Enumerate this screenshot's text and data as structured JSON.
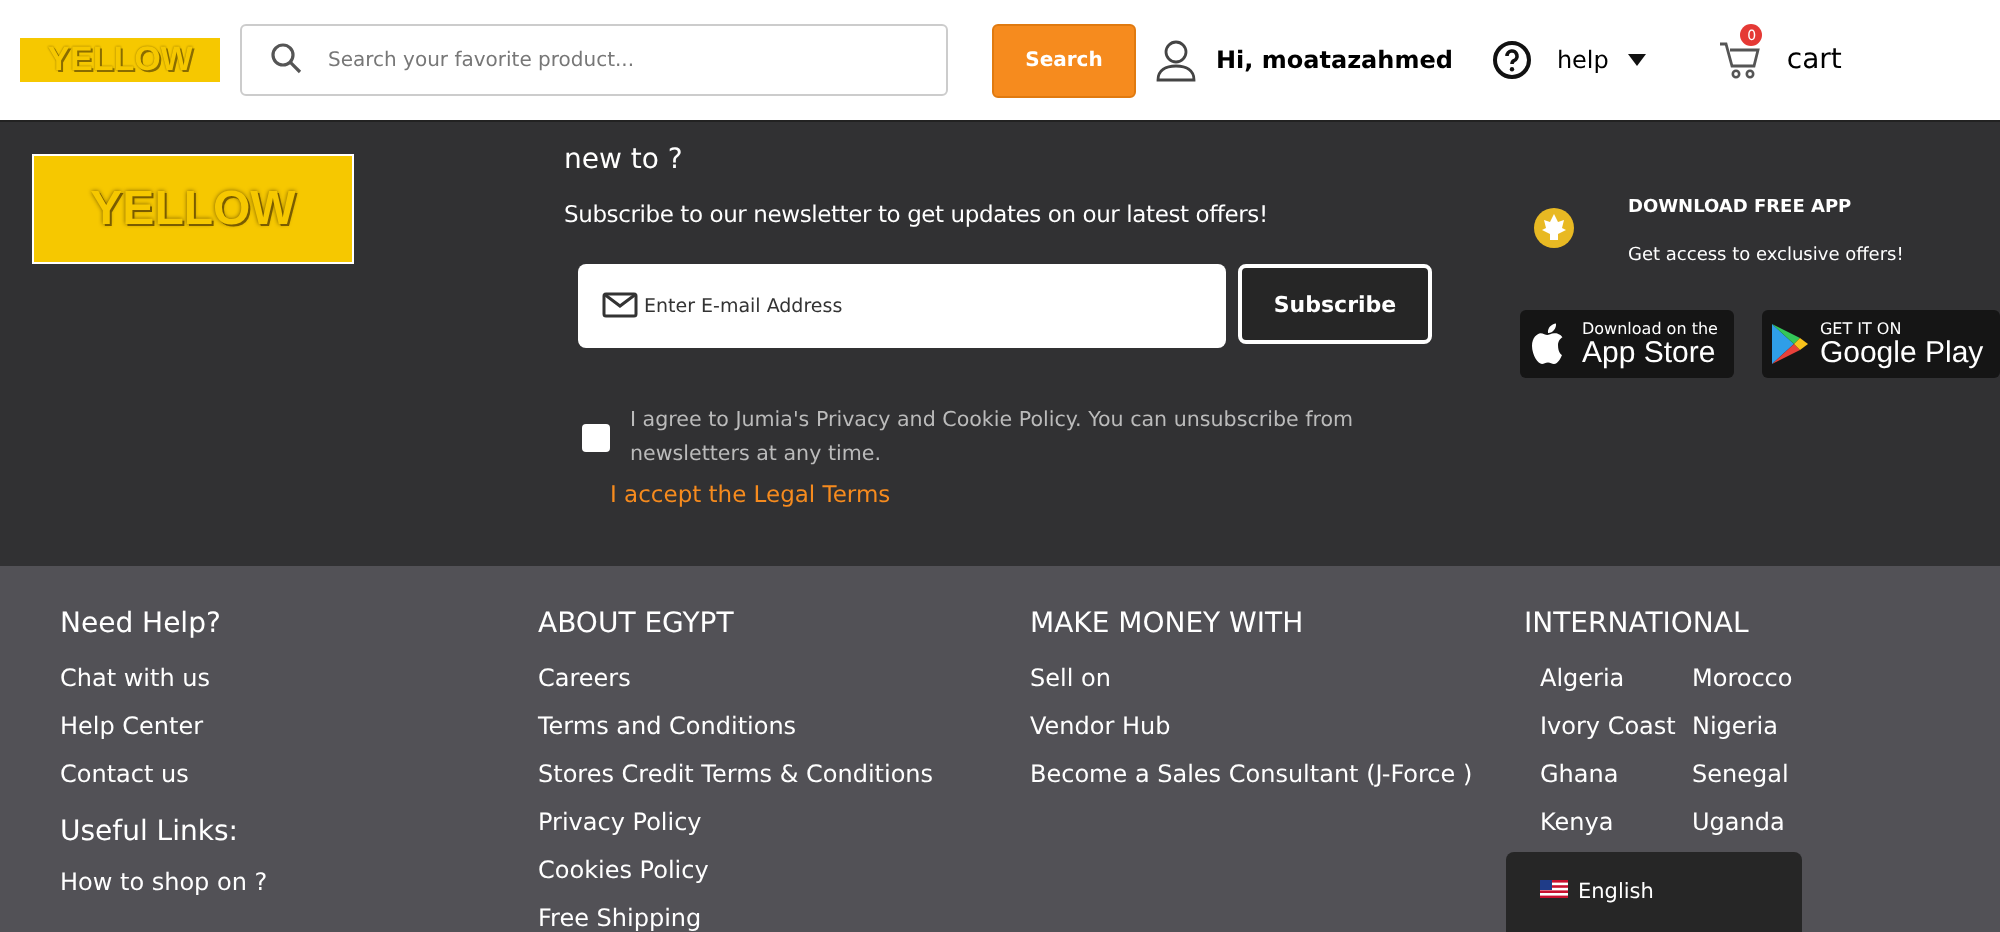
{
  "header": {
    "logo": "YELLOW",
    "search": {
      "placeholder": "Search your favorite product..."
    },
    "search_button": "Search",
    "account": "Hi, moatazahmed",
    "help": "help",
    "cart": {
      "label": "cart",
      "count": "0"
    }
  },
  "newsletter": {
    "logo": "YELLOW",
    "title": "new to ?",
    "subtitle": "Subscribe to our newsletter to get updates on our latest offers!",
    "email": {
      "placeholder": "Enter E-mail Address"
    },
    "subscribe_button": "Subscribe",
    "consent": {
      "checked": false,
      "text": "I agree to Jumia's Privacy and Cookie Policy. You can unsubscribe from newsletters at any time."
    },
    "legal_link": "I accept the Legal Terms"
  },
  "app": {
    "title": "DOWNLOAD  FREE APP",
    "subtitle": "Get access to exclusive offers!",
    "app_store": {
      "small": "Download on the",
      "big": "App Store"
    },
    "google_play": {
      "small": "GET IT ON",
      "big": "Google Play"
    }
  },
  "footer": {
    "columns": [
      {
        "title": "Need Help?",
        "links": [
          "Chat with us",
          "Help Center",
          "Contact us"
        ]
      },
      {
        "title": "ABOUT EGYPT",
        "links": [
          "Careers",
          "Terms and Conditions",
          "Stores Credit Terms & Conditions",
          "Privacy Policy",
          "Cookies Policy",
          "Free Shipping"
        ]
      },
      {
        "title": "MAKE MONEY WITH",
        "links": [
          "Sell on",
          "Vendor Hub",
          "Become a Sales Consultant (J-Force )"
        ]
      },
      {
        "title": "INTERNATIONAL",
        "links": [
          "Algeria",
          "Morocco",
          "Ivory Coast",
          "Nigeria",
          "Ghana",
          "Senegal",
          "Kenya",
          "Uganda"
        ]
      }
    ],
    "useful": {
      "title": "Useful Links:",
      "links": [
        "How to shop on ?"
      ]
    },
    "language": "English"
  }
}
